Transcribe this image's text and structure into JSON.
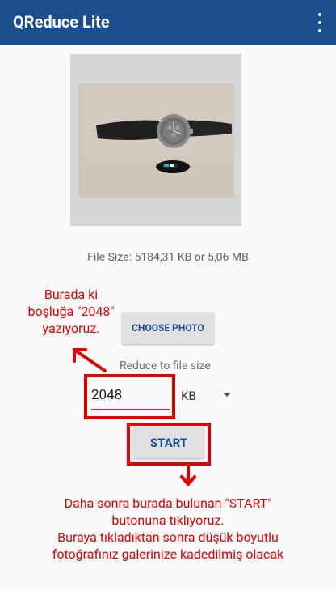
{
  "app": {
    "title": "QReduce Lite"
  },
  "photo": {
    "file_size_text": "File Size: 5184,31 KB or 5,06 MB"
  },
  "controls": {
    "choose_photo_label": "CHOOSE PHOTO",
    "reduce_label": "Reduce to file size",
    "size_value": "2048",
    "unit_selected": "KB",
    "start_label": "START"
  },
  "annotations": {
    "top_left_lines": [
      "Burada ki",
      "boşluğa \"2048\"",
      "yazıyoruz."
    ],
    "bottom_lines": [
      "Daha sonra burada bulunan \"START\"",
      "butonuna tıklıyoruz.",
      "Buraya tıkladıktan sonra düşük boyutlu",
      "fotoğrafınız galerinize kadedilmiş olacak"
    ]
  },
  "colors": {
    "appbar": "#1a4e8f",
    "accent": "#d81b60",
    "annotation_red": "#e00000"
  },
  "icons": [
    "overflow-menu-icon",
    "dropdown-caret-icon"
  ]
}
